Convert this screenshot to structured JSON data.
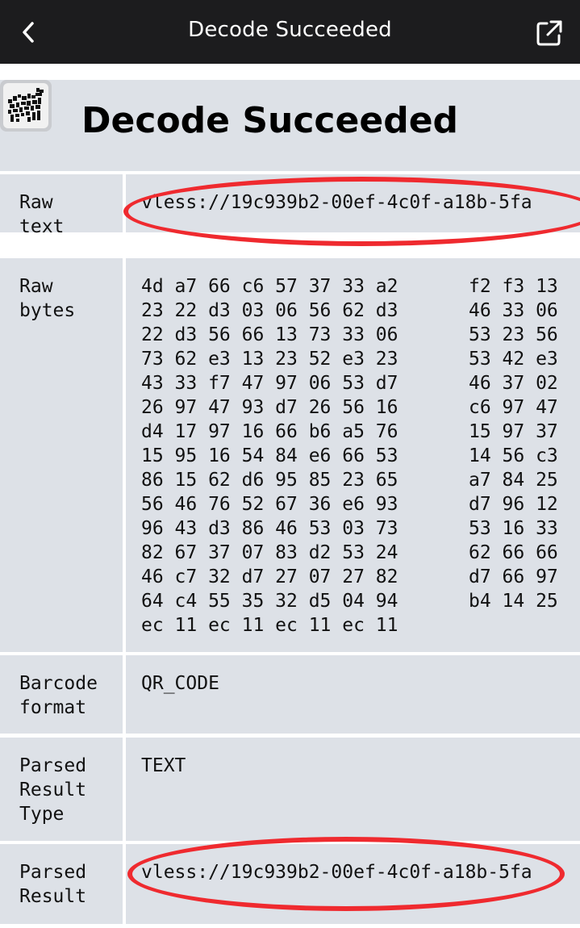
{
  "topbar": {
    "title": "Decode Succeeded"
  },
  "header": {
    "title": "Decode Succeeded",
    "icon": "qr-code-icon"
  },
  "rows": {
    "raw_text": {
      "label": "Raw\ntext",
      "value": "vless://19c939b2-00ef-4c0f-a18b-5fa"
    },
    "raw_bytes": {
      "label": "Raw\nbytes"
    },
    "barcode_format": {
      "label": "Barcode\nformat",
      "value": "QR_CODE"
    },
    "parsed_type": {
      "label": "Parsed\nResult\nType",
      "value": "TEXT"
    },
    "parsed_result": {
      "label": "Parsed\nResult",
      "value": "vless://19c939b2-00ef-4c0f-a18b-5fa"
    }
  },
  "raw_bytes_lines": [
    {
      "left": "4d a7 66 c6 57 37 33 a2",
      "right": "f2 f3 13"
    },
    {
      "left": "23 22 d3 03 06 56 62 d3",
      "right": "46 33 06"
    },
    {
      "left": "22 d3 56 66 13 73 33 06",
      "right": "53 23 56"
    },
    {
      "left": "73 62 e3 13 23 52 e3 23",
      "right": "53 42 e3"
    },
    {
      "left": "43 33 f7 47 97 06 53 d7",
      "right": "46 37 02"
    },
    {
      "left": "26 97 47 93 d7 26 56 16",
      "right": "c6 97 47"
    },
    {
      "left": "d4 17 97 16 66 b6 a5 76",
      "right": "15 97 37"
    },
    {
      "left": "15 95 16 54 84 e6 66 53",
      "right": "14 56 c3"
    },
    {
      "left": "86 15 62 d6 95 85 23 65",
      "right": "a7 84 25"
    },
    {
      "left": "56 46 76 52 67 36 e6 93",
      "right": "d7 96 12"
    },
    {
      "left": "96 43 d3 86 46 53 03 73",
      "right": "53 16 33"
    },
    {
      "left": "82 67 37 07 83 d2 53 24",
      "right": "62 66 66"
    },
    {
      "left": "46 c7 32 d7 27 07 27 82",
      "right": "d7 66 97"
    },
    {
      "left": "64 c4 55 35 32 d5 04 94",
      "right": "b4 14 25"
    },
    {
      "left": "ec 11 ec 11 ec 11 ec 11",
      "right": ""
    }
  ],
  "annotation_color": "#ef2a2f"
}
